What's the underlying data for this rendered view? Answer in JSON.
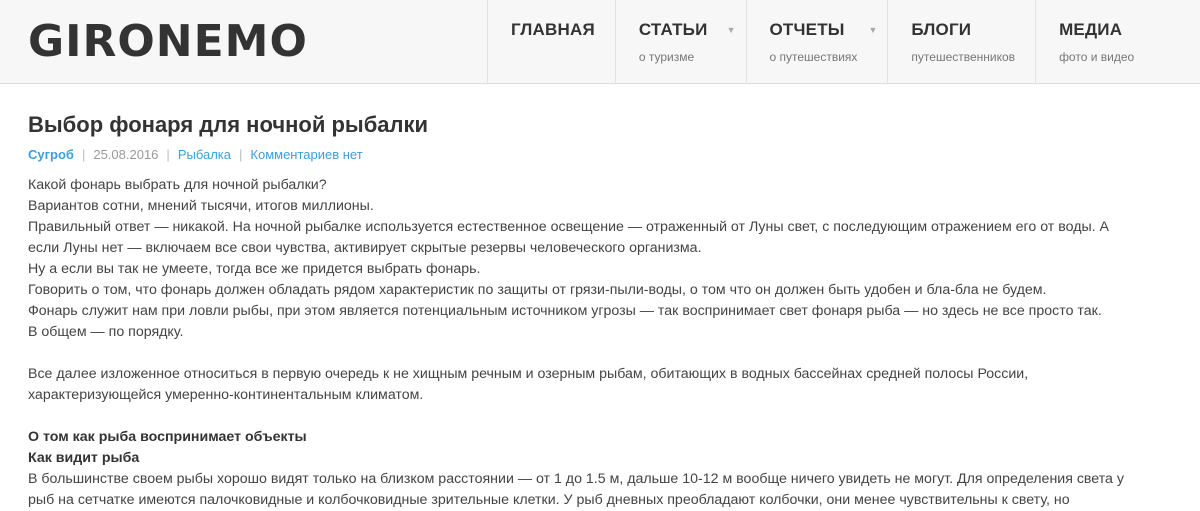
{
  "site": {
    "logo": "GIRONEMO"
  },
  "nav": [
    {
      "title": "ГЛАВНАЯ",
      "sub": "",
      "has_arrow": false
    },
    {
      "title": "СТАТЬИ",
      "sub": "о туризме",
      "has_arrow": true
    },
    {
      "title": "ОТЧЕТЫ",
      "sub": "о путешествиях",
      "has_arrow": true
    },
    {
      "title": "БЛОГИ",
      "sub": "путешественников",
      "has_arrow": false
    },
    {
      "title": "МЕДИА",
      "sub": "фото и видео",
      "has_arrow": false
    }
  ],
  "nav_arrow_glyph": "▼",
  "post": {
    "title": "Выбор фонаря для ночной рыбалки",
    "meta": {
      "author": "Сугроб",
      "date": "25.08.2016",
      "category": "Рыбалка",
      "comments": "Комментариев нет",
      "separator": "|"
    },
    "lines": [
      "Какой фонарь выбрать для ночной рыбалки?",
      "Вариантов сотни, мнений тысячи, итогов миллионы.",
      "Правильный ответ — никакой. На ночной рыбалке используется естественное освещение — отраженный от Луны свет, с последующим отражением его от воды. А",
      "если Луны нет — включаем все свои чувства, активирует скрытые резервы человеческого организма.",
      "Ну а если вы так не умеете, тогда все же придется выбрать фонарь.",
      "Говорить о том, что фонарь должен обладать рядом характеристик по защиты от грязи-пыли-воды, о том что он должен быть удобен и бла-бла не будем.",
      "Фонарь служит нам при ловли рыбы, при этом является потенциальным источником угрозы — так воспринимает свет фонаря рыба — но здесь не все просто так.",
      "В общем — по порядку."
    ],
    "para2": [
      "Все далее изложенное относиться в первую очередь к не хищным речным и озерным рыбам, обитающих в водных бассейнах средней полосы России,",
      "характеризующейся умеренно-континентальным климатом."
    ],
    "heading1": "О том как рыба воспринимает объекты",
    "heading2": "Как видит рыба",
    "para3": [
      "В большинстве своем рыбы хорошо видят только на близком расстоянии — от 1 до 1.5 м, дальше 10-12 м вообще ничего увидеть не могут. Для определения света у",
      "рыб на сетчатке имеются палочковидные и колбочковидные зрительные клетки. У рыб дневных преобладают колбочки, они менее чувствительны к свету, но"
    ]
  }
}
